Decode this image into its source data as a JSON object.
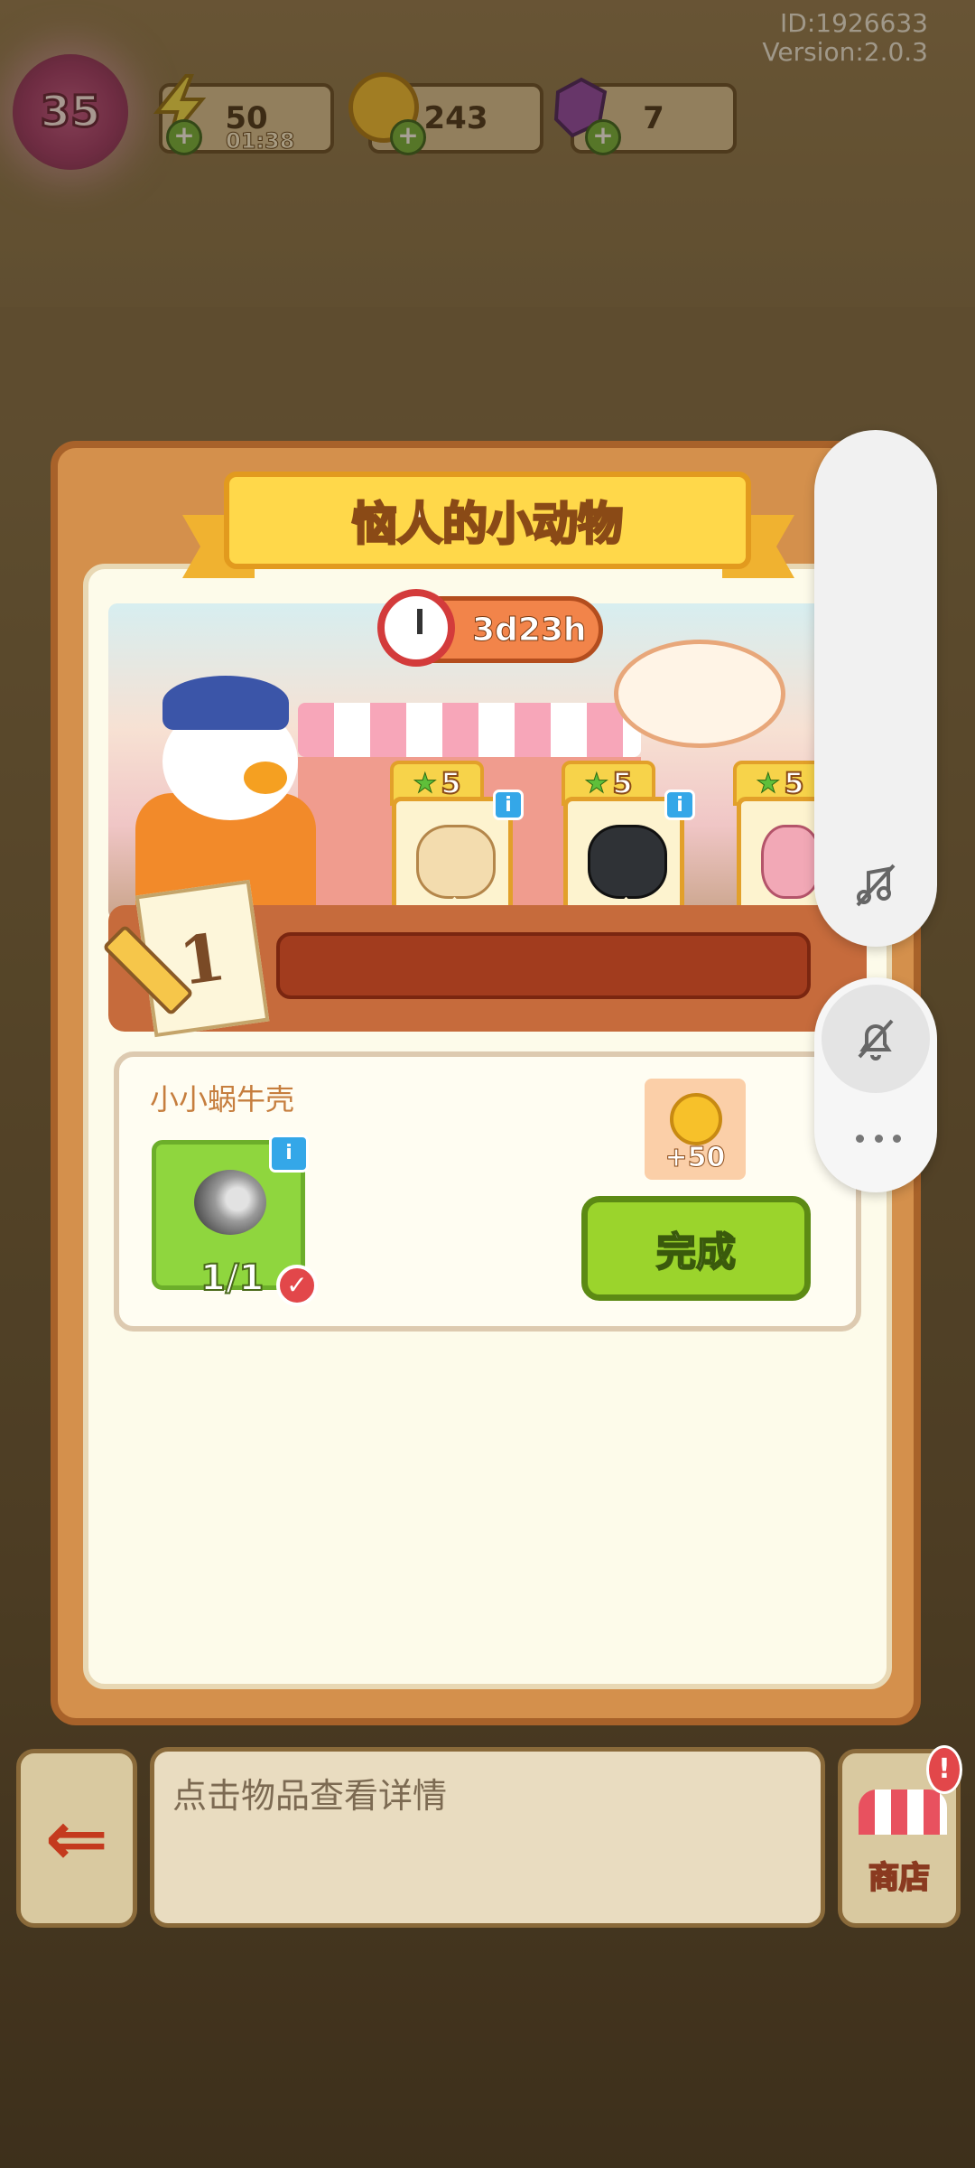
{
  "top_info": {
    "id_text": "ID:1926633",
    "version_text": "Version:2.0.3"
  },
  "hud": {
    "level": "35",
    "energy": {
      "value": "50",
      "timer": "01:38"
    },
    "coins": {
      "value": "243"
    },
    "gems": {
      "value": "7"
    }
  },
  "dialog": {
    "title": "恼人的小动物",
    "timer": "3d23h",
    "rewards": [
      {
        "stars": "5",
        "item": "bread-bag"
      },
      {
        "stars": "5",
        "item": "black-handbag"
      },
      {
        "stars": "5",
        "item": "pink-handbag"
      }
    ],
    "progress_label": "1",
    "task": {
      "name": "小小蜗牛壳",
      "count": "1/1",
      "reward_text": "+50",
      "complete_label": "完成"
    }
  },
  "bottom": {
    "hint_text": "点击物品查看详情",
    "shop_label": "商店",
    "shop_alert": "!"
  },
  "colors": {
    "dialog_bg": "#d4904c",
    "complete_green": "#9bd42c",
    "title_gold": "#ffd84a"
  }
}
